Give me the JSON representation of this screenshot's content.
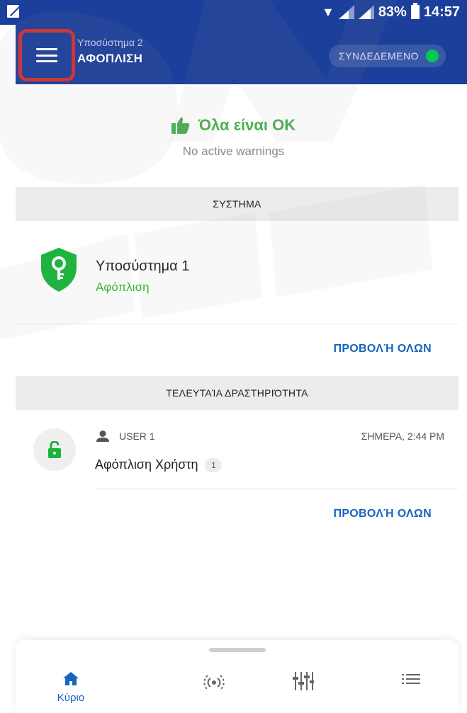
{
  "status_bar": {
    "battery": "83%",
    "time": "14:57"
  },
  "app_bar": {
    "subsystem_label": "Υποσύστημα 2",
    "state_label": "ΑΦΟΠΛΙΣΗ",
    "connection_label": "ΣΥΝΔΕΔΕΜΕΝΟ",
    "connection_color": "#00c853",
    "bar_color": "#1b3f9a"
  },
  "status": {
    "ok_text": "Όλα είναι OK",
    "warnings_text": "No active warnings",
    "ok_color": "#4caf50"
  },
  "system_section": {
    "header": "ΣΥΣΤΗΜΑ",
    "subsystem_name": "Υποσύστημα 1",
    "subsystem_state": "Αφόπλιση",
    "view_all": "ΠΡΟΒΟΛΉ ΟΛΩΝ"
  },
  "activity_section": {
    "header": "ΤΕΛΕΥΤΑΊΑ ΔΡΑΣΤΗΡΙΌΤΗΤΑ",
    "items": [
      {
        "user": "USER 1",
        "time": "ΣΗΜΕΡΑ, 2:44 PM",
        "title": "Αφόπλιση Χρήστη",
        "count": "1",
        "icon": "unlock-icon"
      }
    ],
    "view_all": "ΠΡΟΒΟΛΉ ΟΛΩΝ"
  },
  "bottom_nav": {
    "items": [
      {
        "label": "Κύριο",
        "icon": "home-icon",
        "active": true
      },
      {
        "label": "",
        "icon": "radar-icon",
        "active": false
      },
      {
        "label": "",
        "icon": "sliders-icon",
        "active": false
      },
      {
        "label": "",
        "icon": "list-icon",
        "active": false
      }
    ],
    "accent_color": "#1565c0"
  }
}
